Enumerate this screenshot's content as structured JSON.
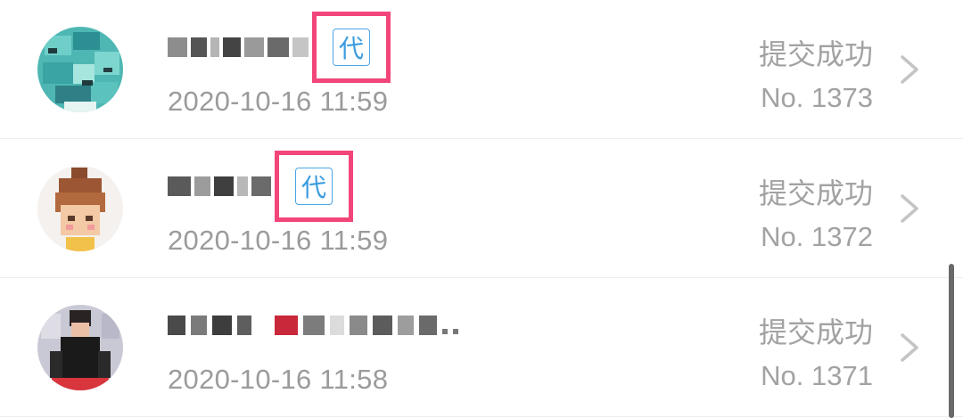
{
  "records": [
    {
      "tag_label": "代",
      "timestamp": "2020-10-16 11:59",
      "status": "提交成功",
      "number": "No. 1373",
      "has_tag": true
    },
    {
      "tag_label": "代",
      "timestamp": "2020-10-16 11:59",
      "status": "提交成功",
      "number": "No. 1372",
      "has_tag": true
    },
    {
      "timestamp": "2020-10-16 11:58",
      "status": "提交成功",
      "number": "No. 1371",
      "has_tag": false
    }
  ],
  "colors": {
    "tag_border": "#4aa6e6",
    "tag_text": "#3a9be0",
    "highlight_box": "#f2467a",
    "secondary_text": "#9b9b9b"
  },
  "icons": {
    "row_chevron": "chevron-right-icon",
    "avatar": "avatar-image"
  }
}
